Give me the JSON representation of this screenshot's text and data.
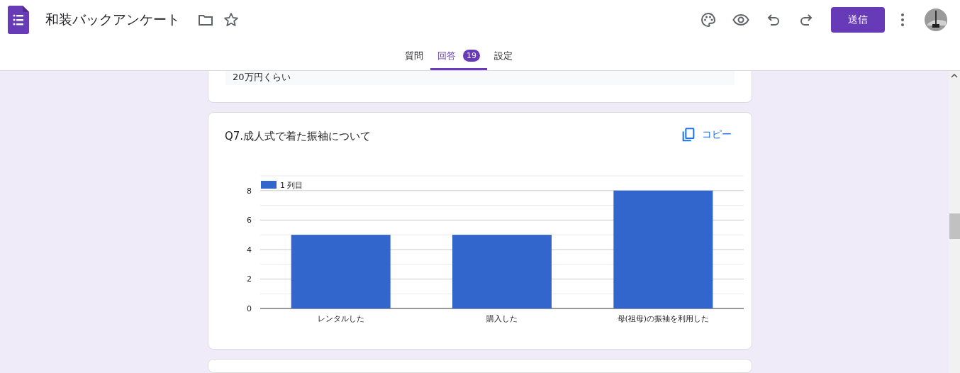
{
  "header": {
    "title": "和装バックアンケート",
    "send_button": "送信"
  },
  "tabs": [
    {
      "label": "質問",
      "selected": false
    },
    {
      "label": "回答",
      "selected": true,
      "badge": "19"
    },
    {
      "label": "設定",
      "selected": false
    }
  ],
  "previous_answer": "20万円くらい",
  "question": {
    "title": "Q7.成人式で着た振袖について",
    "copy_button": "コピー",
    "chart_data": {
      "type": "bar",
      "categories": [
        "レンタルした",
        "購入した",
        "母(祖母)の振袖を利用した"
      ],
      "series": [
        {
          "name": "1 列目",
          "color": "#3366cc",
          "values": [
            5,
            5,
            8
          ]
        }
      ],
      "grid": true,
      "ylim": [
        0,
        9
      ],
      "yticks": [
        0,
        2,
        4,
        6,
        8
      ]
    }
  }
}
